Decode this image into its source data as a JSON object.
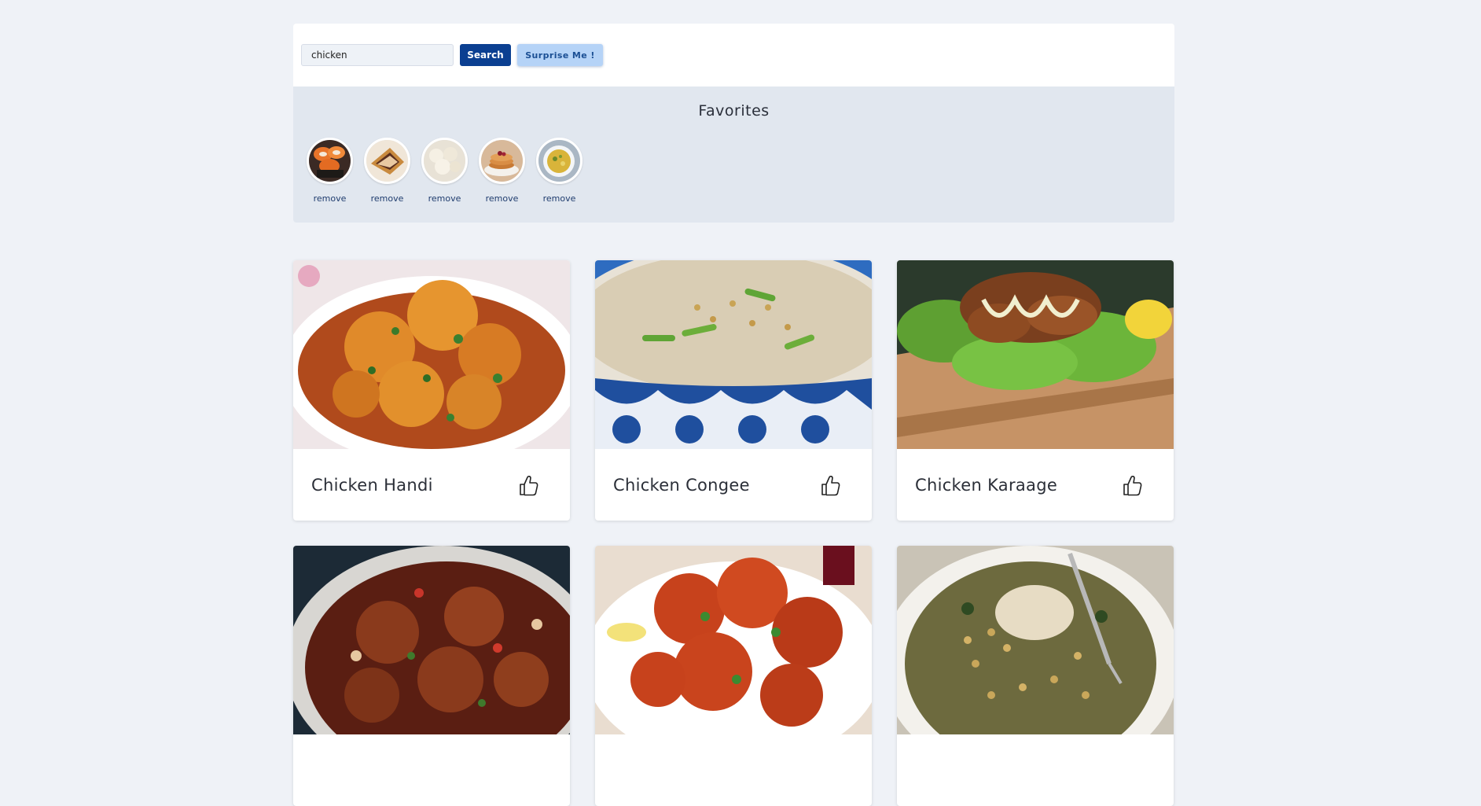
{
  "search": {
    "value": "chicken",
    "button_label": "Search",
    "surprise_label": "Surprise Me !"
  },
  "favorites": {
    "title": "Favorites",
    "items": [
      {
        "name": "sushi",
        "remove_label": "remove"
      },
      {
        "name": "pie",
        "remove_label": "remove"
      },
      {
        "name": "dumplings",
        "remove_label": "remove"
      },
      {
        "name": "pancakes",
        "remove_label": "remove"
      },
      {
        "name": "curry-bowl",
        "remove_label": "remove"
      }
    ]
  },
  "meals": [
    {
      "title": "Chicken Handi",
      "icon": "thumbs-up-icon"
    },
    {
      "title": "Chicken Congee",
      "icon": "thumbs-up-icon"
    },
    {
      "title": "Chicken Karaage",
      "icon": "thumbs-up-icon"
    },
    {
      "title": "",
      "icon": ""
    },
    {
      "title": "",
      "icon": ""
    },
    {
      "title": "",
      "icon": ""
    }
  ],
  "colors": {
    "primary": "#0b3f91",
    "secondary": "#b5d3f7",
    "background": "#eff2f7",
    "favorites_bg": "#e1e7ef"
  }
}
